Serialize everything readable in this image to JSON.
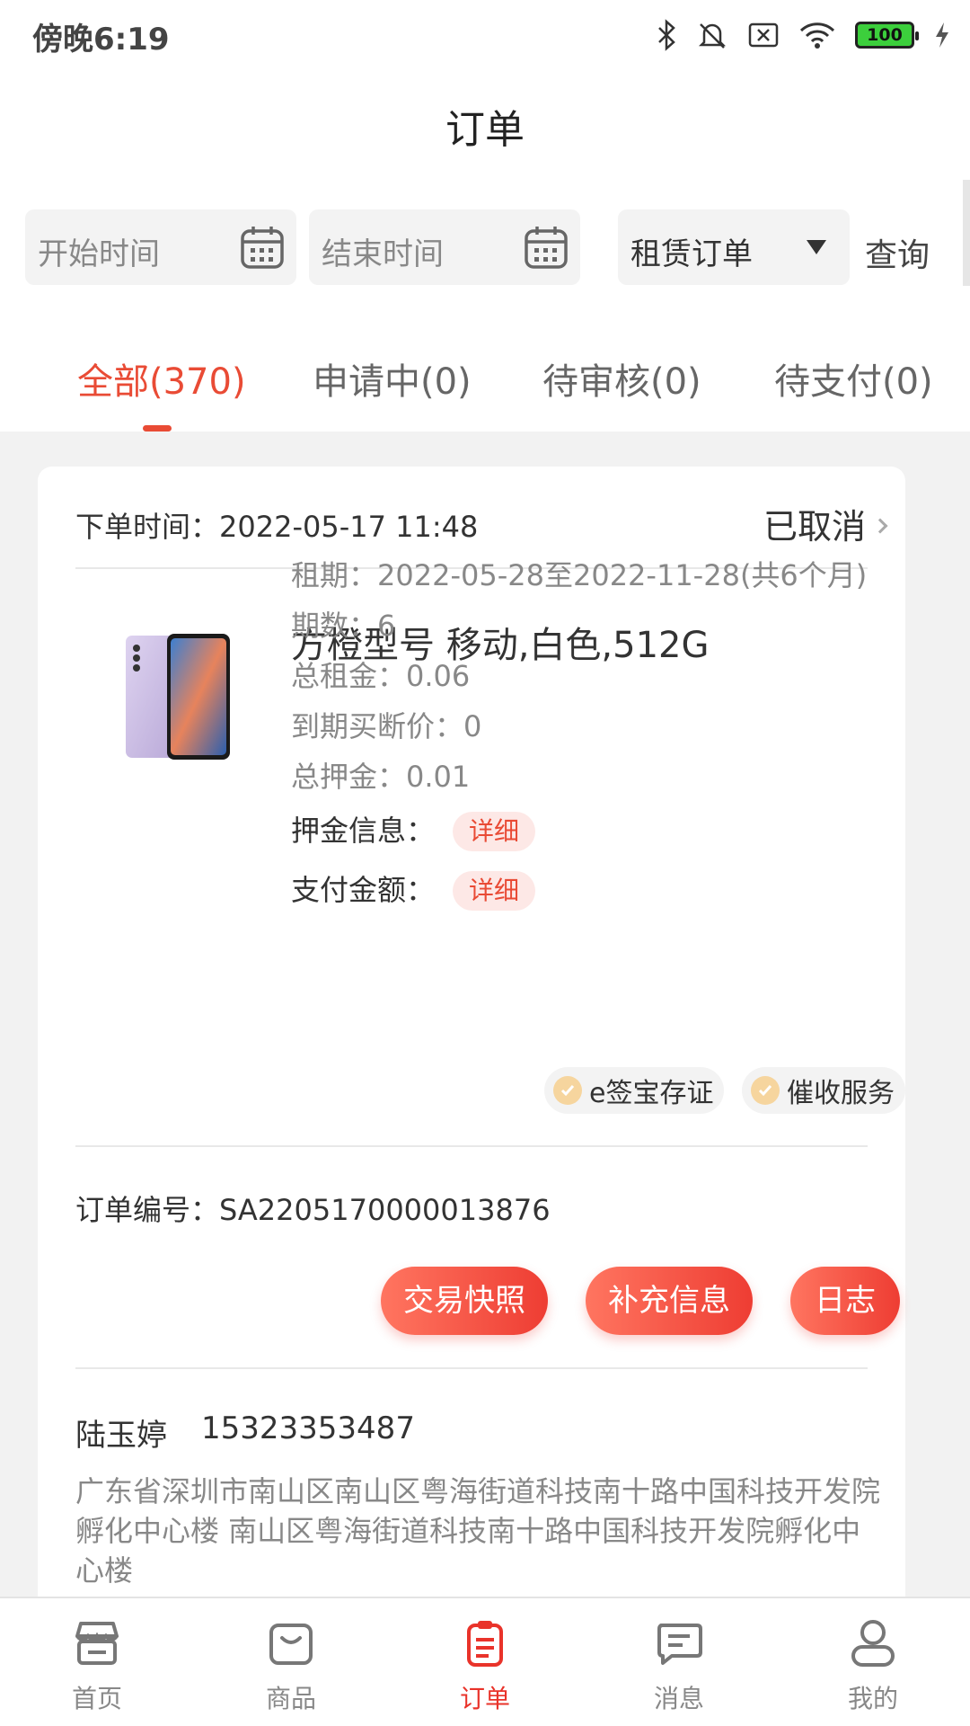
{
  "status_bar": {
    "time": "傍晚6:19",
    "battery": "100"
  },
  "header": {
    "title": "订单"
  },
  "filters": {
    "start_placeholder": "开始时间",
    "end_placeholder": "结束时间",
    "order_type": "租赁订单",
    "query_label": "查询"
  },
  "tabs": [
    {
      "label": "全部(370)",
      "active": true
    },
    {
      "label": "申请中(0)"
    },
    {
      "label": "待审核(0)"
    },
    {
      "label": "待支付(0)"
    }
  ],
  "order": {
    "time_label": "下单时间：2022-05-17 11:48",
    "status": "已取消",
    "product_name": "方橙型号 移动,白色,512G",
    "details": [
      "租期：2022-05-28至2022-11-28(共6个月)",
      "期数：6",
      "总租金：0.06",
      "到期买断价：0",
      "总押金：0.01"
    ],
    "deposit_info_label": "押金信息：",
    "payment_amount_label": "支付金额：",
    "detail_label": "详细",
    "badges": [
      "e签宝存证",
      "催收服务"
    ],
    "order_number": "订单编号：SA2205170000013876",
    "actions": [
      "交易快照",
      "补充信息",
      "日志"
    ],
    "customer_name": "陆玉婷",
    "customer_phone": "15323353487",
    "address": "广东省深圳市南山区南山区粤海街道科技南十路中国科技开发院孵化中心楼 南山区粤海街道科技南十路中国科技开发院孵化中心楼"
  },
  "bottom_nav": [
    {
      "label": "首页",
      "icon": "store-icon"
    },
    {
      "label": "商品",
      "icon": "shopping-bag-icon"
    },
    {
      "label": "订单",
      "icon": "order-clipboard-icon",
      "active": true
    },
    {
      "label": "消息",
      "icon": "message-icon"
    },
    {
      "label": "我的",
      "icon": "user-icon"
    }
  ],
  "colors": {
    "accent": "#e94b35",
    "button_gradient_start": "#ff7560",
    "button_gradient_end": "#ee3d33"
  }
}
